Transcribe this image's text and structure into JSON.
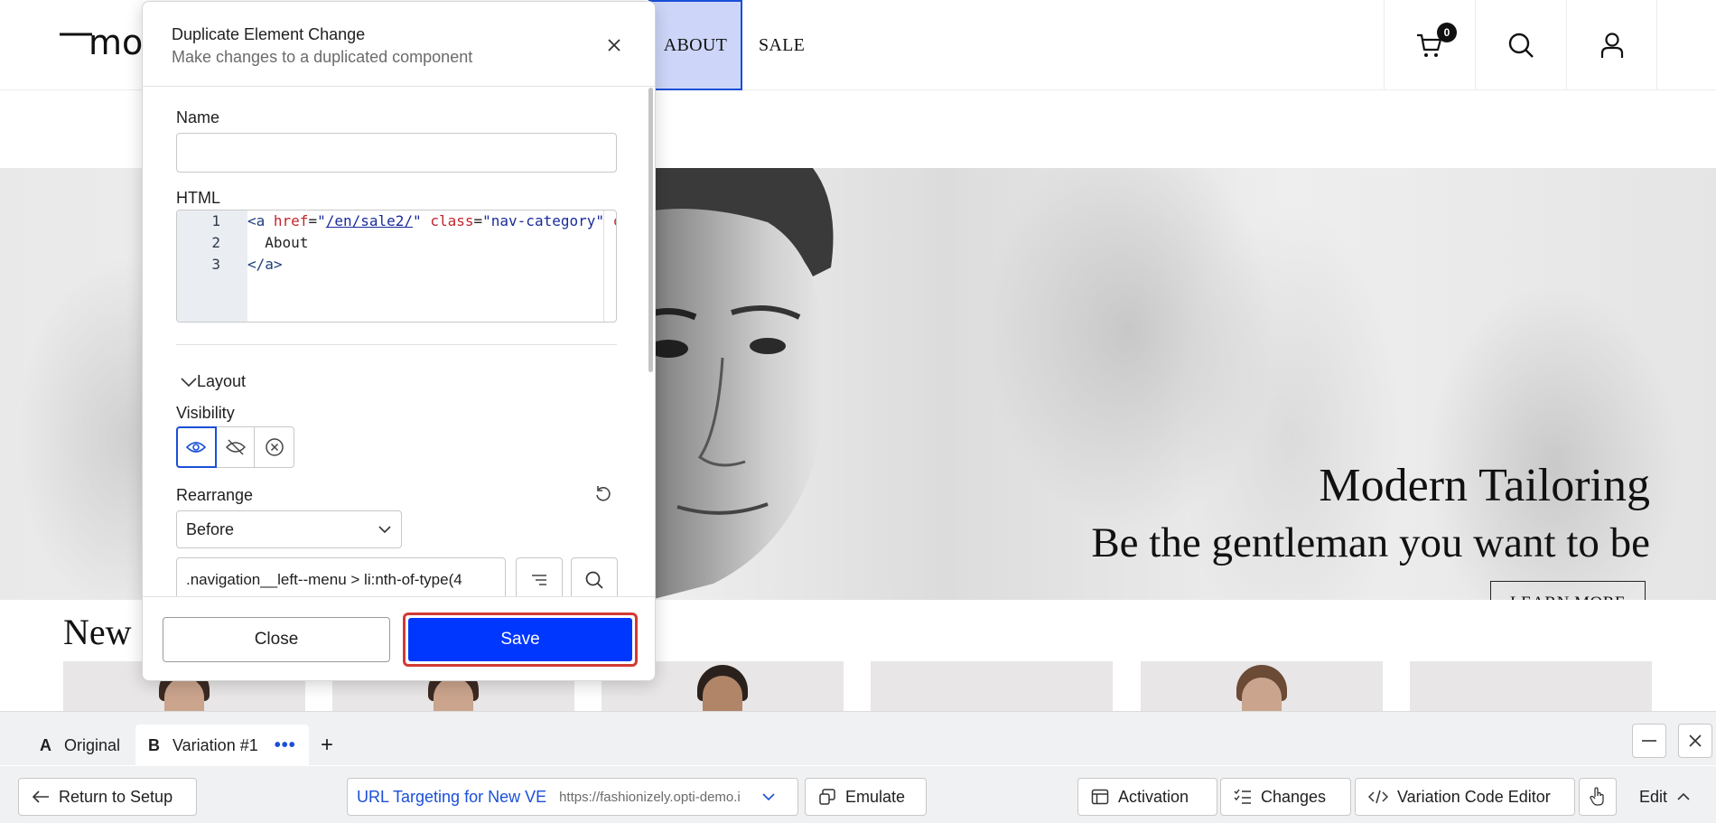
{
  "site": {
    "logo_text": "mo",
    "nav": [
      {
        "label": "ABOUT"
      },
      {
        "label": "SALE"
      }
    ],
    "cart_count": "0",
    "icons": [
      "cart-icon",
      "search-icon",
      "account-icon"
    ]
  },
  "hero": {
    "title": "Modern Tailoring",
    "subtitle": "Be the gentleman you want to be",
    "cta": "LEARN MORE"
  },
  "new_section": {
    "heading": "New"
  },
  "modal": {
    "title": "Duplicate Element Change",
    "subtitle": "Make changes to a duplicated component",
    "name_label": "Name",
    "name_value": "",
    "html_label": "HTML",
    "code_lines": [
      {
        "num": "1"
      },
      {
        "num": "2",
        "text": "  About"
      },
      {
        "num": "3",
        "text": "</a>"
      }
    ],
    "code_line1": {
      "open": "<a",
      "attr1": "href",
      "eq": "=",
      "q1": "\"",
      "url": "/en/sale2/",
      "q2": "\"",
      "attr2": "class",
      "val2": "\"nav-category\"",
      "attr3": "c"
    },
    "layout_label": "Layout",
    "visibility_label": "Visibility",
    "visibility_options": [
      "eye-icon",
      "eye-off-icon",
      "remove-circle-icon"
    ],
    "rearrange_label": "Rearrange",
    "rearrange_value": "Before",
    "selector_value": ".navigation__left--menu > li:nth-of-type(4",
    "close_label": "Close",
    "save_label": "Save"
  },
  "variation_bar": {
    "tabs": [
      {
        "letter": "A",
        "label": "Original"
      },
      {
        "letter": "B",
        "label": "Variation #1"
      }
    ],
    "more": "•••",
    "add": "+"
  },
  "toolbar": {
    "return_label": "Return to Setup",
    "url_targeting_label": "URL Targeting for New VE",
    "url_targeting_url": "https://fashionizely.opti-demo.i",
    "emulate_label": "Emulate",
    "activation_label": "Activation",
    "changes_label": "Changes",
    "code_editor_label": "Variation Code Editor",
    "edit_label": "Edit"
  },
  "colors": {
    "accent": "#0037ff",
    "highlight_border": "#d23a34",
    "selected_nav_bg": "#cdd6f8",
    "link_blue": "#1a4fd8"
  }
}
